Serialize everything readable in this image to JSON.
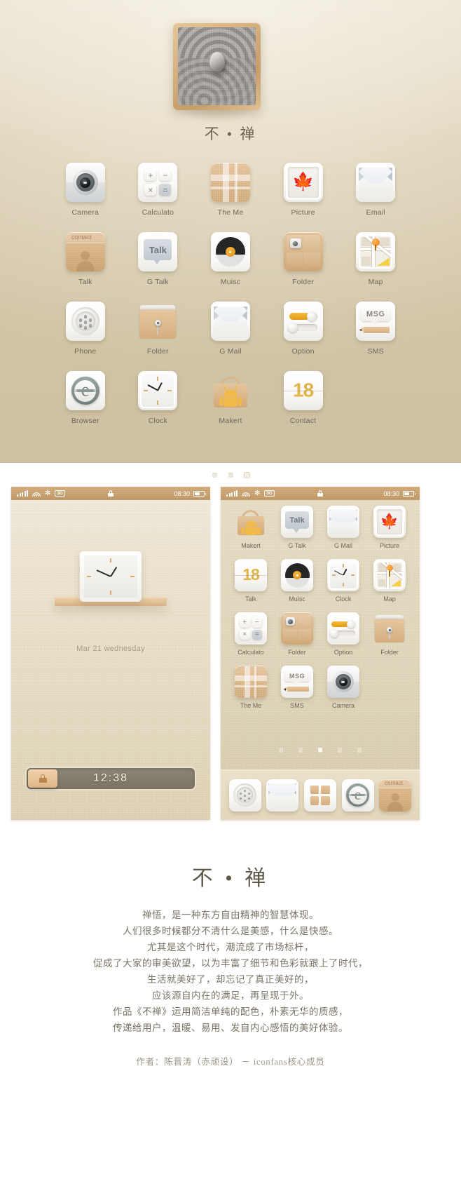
{
  "hero": {
    "title": "不 • 禅",
    "artwork_name": "zen-sand-garden"
  },
  "showcase_icons": [
    {
      "label": "Camera",
      "icon": "camera-icon"
    },
    {
      "label": "Calculato",
      "icon": "calculator-icon"
    },
    {
      "label": "The Me",
      "icon": "plaid-theme-icon"
    },
    {
      "label": "Picture",
      "icon": "maple-leaf-picture-icon"
    },
    {
      "label": "Email",
      "icon": "envelope-icon"
    },
    {
      "label": "Talk",
      "icon": "contact-card-icon"
    },
    {
      "label": "G Talk",
      "icon": "talk-bubble-icon"
    },
    {
      "label": "Muisc",
      "icon": "vinyl-record-icon"
    },
    {
      "label": "Folder",
      "icon": "wood-folder-icon"
    },
    {
      "label": "Map",
      "icon": "map-pin-icon"
    },
    {
      "label": "Phone",
      "icon": "speaker-grille-icon"
    },
    {
      "label": "Folder",
      "icon": "kraft-folder-pin-icon"
    },
    {
      "label": "G Mail",
      "icon": "envelope-icon"
    },
    {
      "label": "Option",
      "icon": "sliders-icon"
    },
    {
      "label": "SMS",
      "icon": "msg-pencil-icon"
    },
    {
      "label": "Browser",
      "icon": "browser-e-icon"
    },
    {
      "label": "Clock",
      "icon": "analog-clock-icon"
    },
    {
      "label": "Makert",
      "icon": "android-bag-icon"
    },
    {
      "label": "Contact",
      "icon": "calendar-18-icon"
    }
  ],
  "calculator_keys": [
    "+",
    "−",
    "×",
    "="
  ],
  "talk_card": {
    "header": "contact"
  },
  "gtalk": {
    "label": "Talk"
  },
  "sms": {
    "label": "MSG"
  },
  "browser": {
    "glyph": "e"
  },
  "calendar": {
    "day": "18"
  },
  "phone_left": {
    "name": "lock-screen",
    "status": {
      "signal": "signal-bars-icon",
      "wifi": "wifi-icon",
      "sync": "sync-icon",
      "network": "3G",
      "lock": "lock-icon",
      "time": "08:30",
      "battery": "battery-icon"
    },
    "date": "Mar 21 wednesday",
    "slider_time": "12:38",
    "slider_handle": "lock-handle-icon"
  },
  "phone_right": {
    "name": "home-screen",
    "status": {
      "signal": "signal-bars-icon",
      "wifi": "wifi-icon",
      "sync": "sync-icon",
      "network": "3G",
      "lock": "lock-icon",
      "time": "08:30",
      "battery": "battery-icon"
    },
    "apps": [
      {
        "label": "Makert",
        "icon": "android-bag-icon"
      },
      {
        "label": "G Talk",
        "icon": "talk-bubble-icon"
      },
      {
        "label": "G Mail",
        "icon": "envelope-icon"
      },
      {
        "label": "Picture",
        "icon": "maple-leaf-picture-icon"
      },
      {
        "label": "Talk",
        "icon": "calendar-18-icon"
      },
      {
        "label": "Muisc",
        "icon": "vinyl-record-icon"
      },
      {
        "label": "Clock",
        "icon": "analog-clock-icon"
      },
      {
        "label": "Map",
        "icon": "map-pin-icon"
      },
      {
        "label": "Calculato",
        "icon": "calculator-icon"
      },
      {
        "label": "Folder",
        "icon": "wood-folder-icon"
      },
      {
        "label": "Option",
        "icon": "sliders-icon"
      },
      {
        "label": "Folder",
        "icon": "kraft-folder-pin-icon"
      },
      {
        "label": "The Me",
        "icon": "plaid-theme-icon"
      },
      {
        "label": "SMS",
        "icon": "msg-pencil-icon"
      },
      {
        "label": "Camera",
        "icon": "camera-icon"
      }
    ],
    "page_dots": {
      "count": 5,
      "active_index": 2
    },
    "dock": [
      {
        "icon": "speaker-grille-icon",
        "name": "dock-phone"
      },
      {
        "icon": "envelope-icon",
        "name": "dock-email"
      },
      {
        "icon": "app-drawer-icon",
        "name": "dock-apps"
      },
      {
        "icon": "browser-e-icon",
        "name": "dock-browser"
      },
      {
        "icon": "contact-card-icon",
        "name": "dock-contact"
      }
    ]
  },
  "page_dots_top": {
    "count": 3,
    "active_index": 2
  },
  "story": {
    "title": "不 • 禅",
    "lines": [
      "禅悟，是一种东方自由精神的智慧体现。",
      "人们很多时候都分不清什么是美感，什么是快感。",
      "尤其是这个时代，潮流成了市场标杆，",
      "促成了大家的审美欲望，以为丰富了细节和色彩就跟上了时代，",
      "生活就美好了，却忘记了真正美好的，",
      "应该源自内在的满足，再呈现于外。",
      "作品《不禅》运用简洁单纯的配色，朴素无华的质感，",
      "传递给用户，温暖、易用、发自内心感悟的美好体验。"
    ],
    "credit": "作者：陈晋涛（赤顽设） － iconfans核心成员"
  },
  "colors": {
    "bg_warm": "#e0d5ba",
    "wood": "#c79d68",
    "accent_gold": "#e0b44a",
    "orange": "#e8811a",
    "text": "#6f675a"
  }
}
